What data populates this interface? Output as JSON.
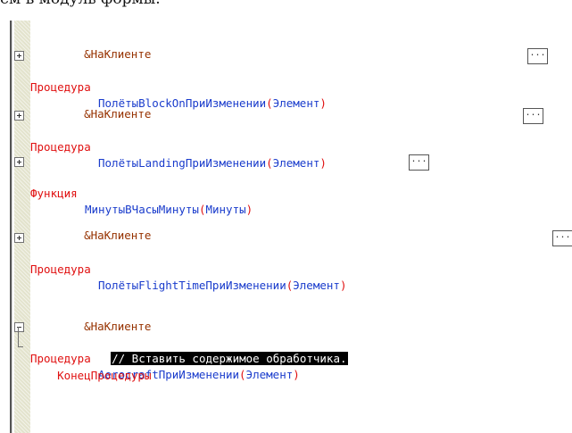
{
  "top_fragment": "ем в модуль формы.",
  "lines": [
    {
      "type": "directive",
      "text": "&НаКлиенте"
    },
    {
      "kw": "Процедура",
      "name": "ПолётыBlockOnПриИзменении",
      "params": "Элемент",
      "button": "..."
    },
    {
      "type": "directive",
      "text": "&НаКлиенте"
    },
    {
      "kw": "Процедура",
      "name": "ПолётыLandingПриИзменении",
      "params": "Элемент",
      "button": "..."
    },
    {
      "kw": "Функция",
      "name": "МинутыВЧасыМинуты",
      "params": "Минуты",
      "button": "..."
    },
    {
      "type": "directive",
      "text": "&НаКлиенте"
    },
    {
      "kw": "Процедура",
      "name": "ПолётыFlightTimeПриИзменении",
      "params": "Элемент",
      "button": "..."
    },
    {
      "type": "directive",
      "text": "&НаКлиенте"
    },
    {
      "kw": "Процедура",
      "name": "AerocraftПриИзменении",
      "params": "Элемент"
    },
    {
      "type": "comment",
      "text": "// Вставить содержимое обработчика."
    },
    {
      "type": "end",
      "text": "КонецПроцедуры"
    }
  ],
  "colors": {
    "keyword": "#e01010",
    "identifier": "#1a3ccc",
    "directive": "#963200",
    "gutter": "#e3e3cd"
  }
}
